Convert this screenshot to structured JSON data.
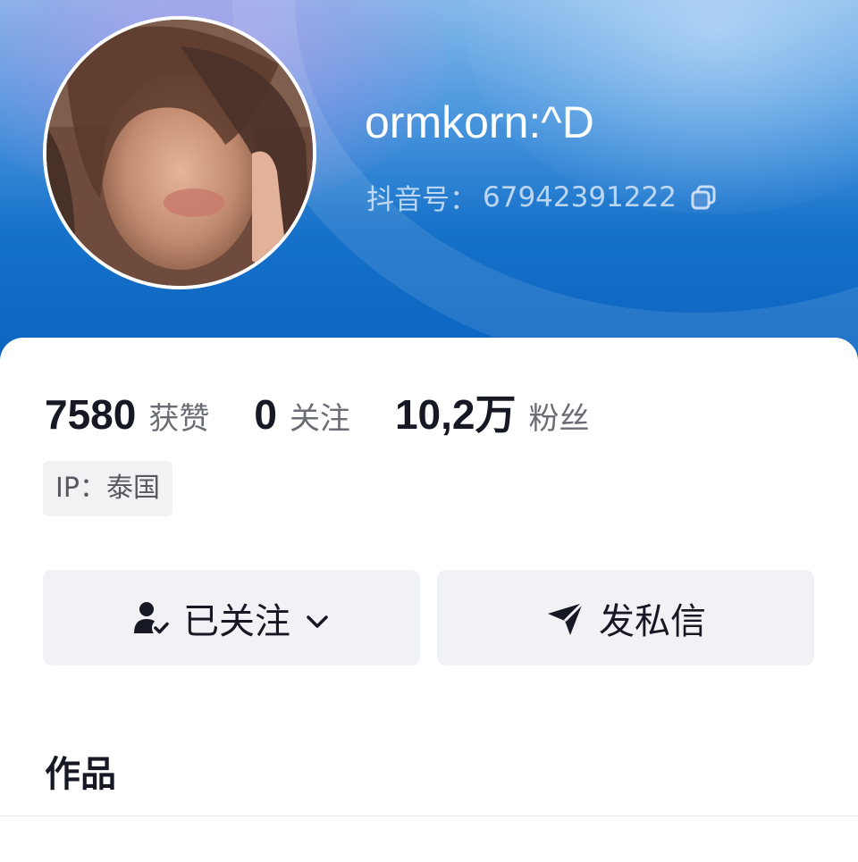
{
  "profile": {
    "username": "ormkorn:^D",
    "douyin_id_label": "抖音号：",
    "douyin_id": "67942391222"
  },
  "stats": [
    {
      "value": "7580",
      "label": "获赞"
    },
    {
      "value": "0",
      "label": "关注"
    },
    {
      "value": "10,2万",
      "label": "粉丝"
    }
  ],
  "ip": "IP：泰国",
  "buttons": {
    "follow_label": "已关注",
    "message_label": "发私信"
  },
  "works_tab": "作品",
  "icons": {
    "copy": "copy-icon",
    "followed_user": "user-check-icon",
    "dropdown": "chevron-down-icon",
    "send": "send-icon"
  },
  "colors": {
    "header_blue": "#0a63c0",
    "text_primary": "#161823",
    "text_secondary": "#6b6d75",
    "button_bg": "#f1f2f5"
  }
}
